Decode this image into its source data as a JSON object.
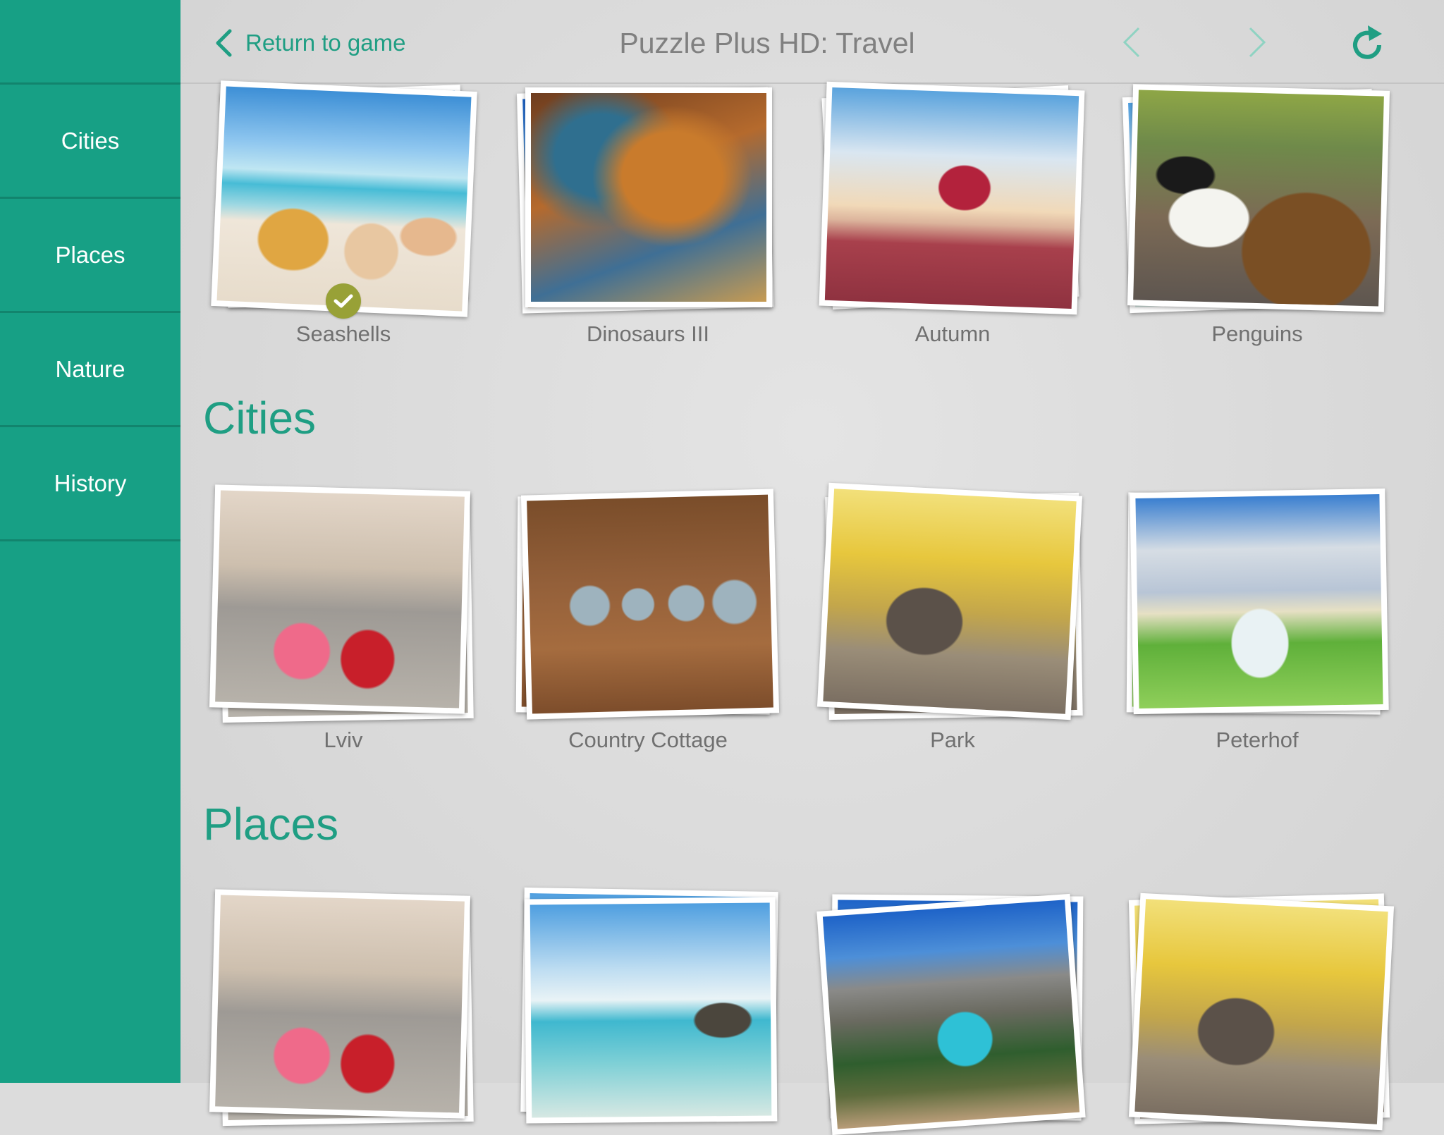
{
  "header": {
    "back_label": "Return to game",
    "title": "Puzzle Plus HD: Travel",
    "prev_enabled": false,
    "next_enabled": false
  },
  "colors": {
    "accent": "#1f9e83",
    "sidebar_bg": "#17a085",
    "sidebar_divider": "#12846d",
    "completed_badge": "#98a137",
    "nav_disabled": "#8fd3c2",
    "label_text": "#707070",
    "title_text": "#808080"
  },
  "icons": {
    "back": "chevron-left-icon",
    "prev": "chevron-left-icon",
    "next": "chevron-right-icon",
    "refresh": "refresh-icon",
    "completed": "checkmark-icon"
  },
  "sidebar": {
    "items": [
      {
        "label": "Cities"
      },
      {
        "label": "Places"
      },
      {
        "label": "Nature"
      },
      {
        "label": "History"
      }
    ]
  },
  "sections": [
    {
      "title": "",
      "puzzles": [
        {
          "label": "Seashells",
          "completed": true
        },
        {
          "label": "Dinosaurs III",
          "completed": false
        },
        {
          "label": "Autumn",
          "completed": false
        },
        {
          "label": "Penguins",
          "completed": false
        }
      ]
    },
    {
      "title": "Cities",
      "puzzles": [
        {
          "label": "Lviv",
          "completed": false
        },
        {
          "label": "Country Cottage",
          "completed": false
        },
        {
          "label": "Park",
          "completed": false
        },
        {
          "label": "Peterhof",
          "completed": false
        }
      ]
    },
    {
      "title": "Places",
      "puzzles": [
        {
          "label": "",
          "completed": false
        },
        {
          "label": "",
          "completed": false
        },
        {
          "label": "",
          "completed": false
        },
        {
          "label": "",
          "completed": false
        }
      ]
    }
  ]
}
